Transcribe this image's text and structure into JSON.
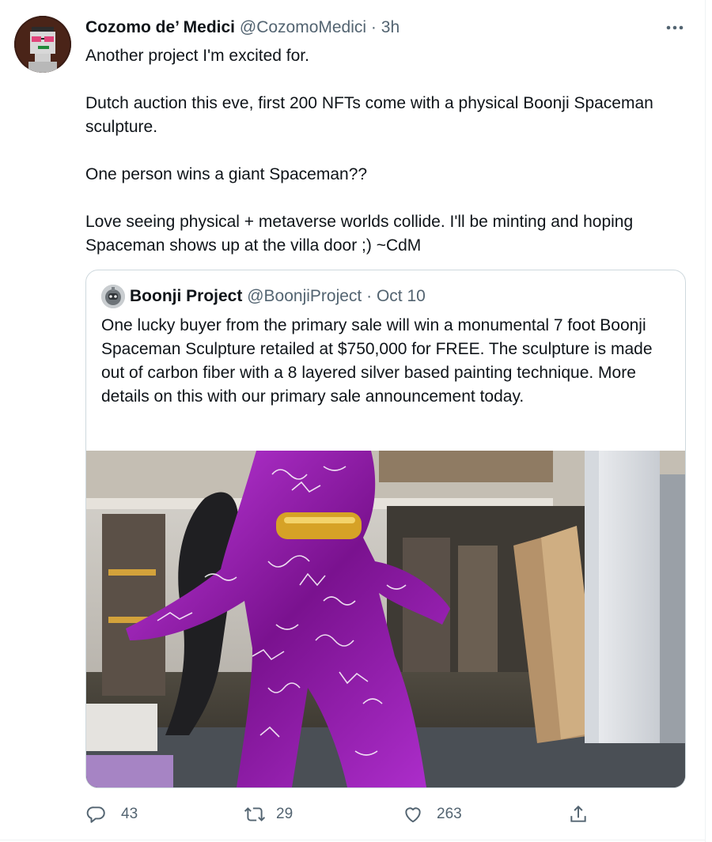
{
  "tweet": {
    "author_name": "Cozomo de’ Medici",
    "handle": "@CozomoMedici",
    "separator": "·",
    "time": "3h",
    "paragraphs": [
      "Another project I'm excited for.",
      "Dutch auction this eve, first 200 NFTs come with a physical Boonji Spaceman sculpture.",
      "One person wins a giant Spaceman??",
      "Love seeing physical + metaverse worlds collide. I'll be minting and hoping Spaceman shows up at the villa door ;) ~CdM"
    ]
  },
  "quoted": {
    "author_name": "Boonji Project",
    "handle": "@BoonjiProject",
    "separator": "·",
    "time": "Oct 10",
    "text": "One lucky buyer from the primary sale will win a monumental 7 foot Boonji Spaceman Sculpture retailed at $750,000 for FREE. The sculpture is made out of carbon fiber with a 8 layered silver based painting technique. More details on this with our primary sale announcement today."
  },
  "actions": {
    "reply": {
      "icon": "reply-icon",
      "count": "43"
    },
    "retweet": {
      "icon": "retweet-icon",
      "count": "29"
    },
    "like": {
      "icon": "heart-icon",
      "count": "263"
    },
    "share": {
      "icon": "share-icon"
    }
  },
  "colors": {
    "text": "#0f1419",
    "secondary": "#536471",
    "border": "#cfd9de",
    "sculpture": "#8a1fa8"
  }
}
